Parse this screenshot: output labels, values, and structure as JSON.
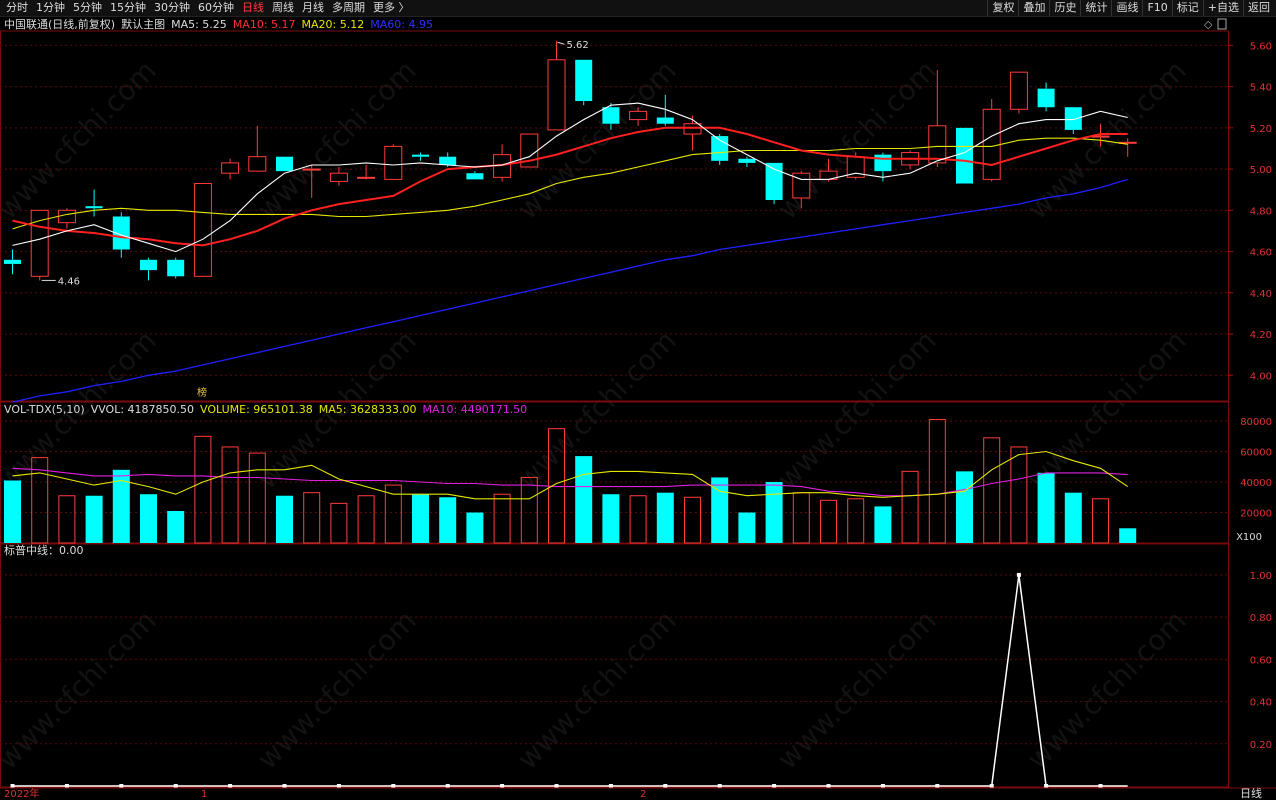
{
  "toolbar": {
    "periods": [
      "分时",
      "1分钟",
      "5分钟",
      "15分钟",
      "30分钟",
      "60分钟",
      "日线",
      "周线",
      "月线",
      "多周期",
      "更多 〉"
    ],
    "active_period": "日线",
    "right_buttons": [
      "复权",
      "叠加",
      "历史",
      "统计",
      "画线",
      "F10",
      "标记",
      "+自选",
      "返回"
    ]
  },
  "main_legend": {
    "stock": "中国联通(日线,前复权)",
    "indicator": "默认主图",
    "ma5": "MA5: 5.25",
    "ma10": "MA10: 5.17",
    "ma20": "MA20: 5.12",
    "ma60": "MA60: 4.95"
  },
  "vol_legend": {
    "name": "VOL-TDX(5,10)",
    "vvol": "VVOL: 4187850.50",
    "volume": "VOLUME: 965101.38",
    "ma5": "MA5: 3628333.00",
    "ma10": "MA10: 4490171.50"
  },
  "ind_legend": {
    "text": "标普中线：0.00"
  },
  "price_axis": [
    "5.60",
    "5.40",
    "5.20",
    "5.00",
    "4.80",
    "4.60",
    "4.40",
    "4.20",
    "4.00"
  ],
  "vol_axis": [
    "80000",
    "60000",
    "40000",
    "20000"
  ],
  "vol_unit": "X100",
  "ind_axis": [
    "1.00",
    "0.80",
    "0.60",
    "0.40",
    "0.20"
  ],
  "annotations": {
    "high": "5.62",
    "low": "4.46",
    "bang": "榜"
  },
  "bottom": {
    "year": "2022年",
    "m1": "1",
    "m2": "2",
    "period": "日线"
  },
  "watermark": "www.cfchi.com",
  "colors": {
    "up": "#ff3b3b",
    "down": "#00ffff",
    "ma5": "#ffffff",
    "ma10": "#ff2020",
    "ma20": "#e6e600",
    "ma60": "#2020ff",
    "vma5": "#e6e600",
    "vma10": "#e020e0"
  },
  "chart_data": {
    "type": "candlestick",
    "price_ylim": [
      3.88,
      5.66
    ],
    "candles": [
      {
        "o": 4.56,
        "c": 4.54,
        "h": 4.61,
        "l": 4.49
      },
      {
        "o": 4.48,
        "c": 4.8,
        "h": 4.8,
        "l": 4.46
      },
      {
        "o": 4.74,
        "c": 4.8,
        "h": 4.81,
        "l": 4.71
      },
      {
        "o": 4.82,
        "c": 4.81,
        "h": 4.9,
        "l": 4.77
      },
      {
        "o": 4.77,
        "c": 4.61,
        "h": 4.79,
        "l": 4.57
      },
      {
        "o": 4.56,
        "c": 4.51,
        "h": 4.57,
        "l": 4.46
      },
      {
        "o": 4.56,
        "c": 4.48,
        "h": 4.57,
        "l": 4.47
      },
      {
        "o": 4.48,
        "c": 4.93,
        "h": 4.93,
        "l": 4.48
      },
      {
        "o": 4.98,
        "c": 5.03,
        "h": 5.05,
        "l": 4.95
      },
      {
        "o": 4.99,
        "c": 5.06,
        "h": 5.21,
        "l": 4.99
      },
      {
        "o": 5.06,
        "c": 4.99,
        "h": 5.06,
        "l": 4.99
      },
      {
        "o": 5.0,
        "c": 5.0,
        "h": 5.02,
        "l": 4.86
      },
      {
        "o": 4.94,
        "c": 4.98,
        "h": 5.01,
        "l": 4.92
      },
      {
        "o": 4.96,
        "c": 4.96,
        "h": 5.02,
        "l": 4.95
      },
      {
        "o": 4.95,
        "c": 5.11,
        "h": 5.12,
        "l": 4.95
      },
      {
        "o": 5.07,
        "c": 5.06,
        "h": 5.08,
        "l": 5.04
      },
      {
        "o": 5.06,
        "c": 5.02,
        "h": 5.08,
        "l": 5.01
      },
      {
        "o": 4.98,
        "c": 4.95,
        "h": 4.99,
        "l": 4.95
      },
      {
        "o": 4.96,
        "c": 5.07,
        "h": 5.12,
        "l": 4.94
      },
      {
        "o": 5.01,
        "c": 5.17,
        "h": 5.17,
        "l": 5.01
      },
      {
        "o": 5.19,
        "c": 5.53,
        "h": 5.62,
        "l": 5.19
      },
      {
        "o": 5.53,
        "c": 5.33,
        "h": 5.53,
        "l": 5.31
      },
      {
        "o": 5.3,
        "c": 5.22,
        "h": 5.32,
        "l": 5.19
      },
      {
        "o": 5.24,
        "c": 5.28,
        "h": 5.3,
        "l": 5.21
      },
      {
        "o": 5.25,
        "c": 5.22,
        "h": 5.36,
        "l": 5.21
      },
      {
        "o": 5.17,
        "c": 5.22,
        "h": 5.26,
        "l": 5.09
      },
      {
        "o": 5.16,
        "c": 5.04,
        "h": 5.17,
        "l": 5.02
      },
      {
        "o": 5.05,
        "c": 5.03,
        "h": 5.06,
        "l": 5.01
      },
      {
        "o": 5.03,
        "c": 4.85,
        "h": 5.03,
        "l": 4.83
      },
      {
        "o": 4.86,
        "c": 4.98,
        "h": 4.99,
        "l": 4.81
      },
      {
        "o": 4.95,
        "c": 4.99,
        "h": 5.05,
        "l": 4.94
      },
      {
        "o": 4.96,
        "c": 5.06,
        "h": 5.08,
        "l": 4.95
      },
      {
        "o": 5.07,
        "c": 4.99,
        "h": 5.08,
        "l": 4.94
      },
      {
        "o": 5.02,
        "c": 5.08,
        "h": 5.09,
        "l": 5.0
      },
      {
        "o": 5.03,
        "c": 5.21,
        "h": 5.48,
        "l": 5.01
      },
      {
        "o": 5.2,
        "c": 4.93,
        "h": 5.2,
        "l": 4.93
      },
      {
        "o": 4.95,
        "c": 5.29,
        "h": 5.34,
        "l": 4.94
      },
      {
        "o": 5.29,
        "c": 5.47,
        "h": 5.47,
        "l": 5.27
      },
      {
        "o": 5.39,
        "c": 5.3,
        "h": 5.42,
        "l": 5.28
      },
      {
        "o": 5.3,
        "c": 5.19,
        "h": 5.3,
        "l": 5.17
      },
      {
        "o": 5.16,
        "c": 5.16,
        "h": 5.22,
        "l": 5.11
      },
      {
        "o": 5.13,
        "c": 5.13,
        "h": 5.15,
        "l": 5.06
      }
    ],
    "ma5": [
      4.63,
      4.66,
      4.7,
      4.73,
      4.68,
      4.64,
      4.6,
      4.66,
      4.75,
      4.88,
      4.98,
      5.02,
      5.02,
      5.03,
      5.02,
      5.03,
      5.02,
      5.01,
      5.02,
      5.06,
      5.16,
      5.24,
      5.31,
      5.32,
      5.29,
      5.24,
      5.14,
      5.07,
      5.0,
      4.95,
      4.95,
      4.98,
      4.96,
      4.98,
      5.04,
      5.08,
      5.16,
      5.22,
      5.24,
      5.24,
      5.28,
      5.25
    ],
    "ma10": [
      4.75,
      4.72,
      4.7,
      4.69,
      4.67,
      4.66,
      4.64,
      4.63,
      4.66,
      4.7,
      4.76,
      4.8,
      4.83,
      4.85,
      4.87,
      4.94,
      5.0,
      5.01,
      5.02,
      5.04,
      5.07,
      5.11,
      5.15,
      5.18,
      5.2,
      5.2,
      5.2,
      5.17,
      5.13,
      5.09,
      5.07,
      5.06,
      5.05,
      5.05,
      5.05,
      5.04,
      5.02,
      5.06,
      5.1,
      5.14,
      5.17,
      5.17
    ],
    "ma20": [
      4.71,
      4.75,
      4.78,
      4.8,
      4.81,
      4.8,
      4.8,
      4.79,
      4.78,
      4.78,
      4.78,
      4.78,
      4.77,
      4.77,
      4.78,
      4.79,
      4.8,
      4.82,
      4.85,
      4.88,
      4.93,
      4.96,
      4.98,
      5.01,
      5.04,
      5.07,
      5.08,
      5.09,
      5.09,
      5.09,
      5.09,
      5.1,
      5.1,
      5.1,
      5.11,
      5.11,
      5.11,
      5.14,
      5.15,
      5.15,
      5.14,
      5.12
    ],
    "ma60": [
      3.87,
      3.9,
      3.92,
      3.95,
      3.97,
      4.0,
      4.02,
      4.05,
      4.08,
      4.11,
      4.14,
      4.17,
      4.2,
      4.23,
      4.26,
      4.29,
      4.32,
      4.35,
      4.38,
      4.41,
      4.44,
      4.47,
      4.5,
      4.53,
      4.56,
      4.58,
      4.61,
      4.63,
      4.65,
      4.67,
      4.69,
      4.71,
      4.73,
      4.75,
      4.77,
      4.79,
      4.81,
      4.83,
      4.86,
      4.88,
      4.91,
      4.95
    ],
    "vol_ylim": [
      0,
      82000
    ],
    "volume": [
      41000,
      56000,
      31000,
      31000,
      48000,
      32000,
      21000,
      70000,
      63000,
      59000,
      31000,
      33000,
      26000,
      31000,
      38000,
      32000,
      30000,
      20000,
      32000,
      43000,
      75000,
      57000,
      32000,
      31000,
      33000,
      30000,
      43000,
      20000,
      40000,
      33000,
      28000,
      29000,
      24000,
      47000,
      81000,
      47000,
      69000,
      63000,
      46000,
      33000,
      29000,
      9650
    ],
    "vol_ma5": [
      44000,
      46000,
      42000,
      38000,
      41000,
      37000,
      32000,
      40000,
      46000,
      48000,
      48000,
      51000,
      42000,
      37000,
      32000,
      32000,
      32000,
      29000,
      29000,
      29000,
      39000,
      45000,
      47000,
      47000,
      46000,
      45000,
      34000,
      31000,
      32000,
      33000,
      33000,
      31000,
      30000,
      31000,
      32000,
      34000,
      48000,
      58000,
      60000,
      54000,
      49000,
      37000
    ],
    "vol_ma10": [
      49000,
      48000,
      46000,
      44000,
      44000,
      45000,
      44000,
      44000,
      43000,
      43000,
      42000,
      41000,
      41000,
      41000,
      41000,
      40000,
      39000,
      39000,
      38000,
      38000,
      37000,
      37000,
      37000,
      37000,
      37000,
      38000,
      38000,
      38000,
      38000,
      37000,
      34000,
      33000,
      31000,
      31000,
      32000,
      35000,
      39000,
      42000,
      46000,
      46000,
      46000,
      44900
    ],
    "indicator": [
      0,
      0,
      0,
      0,
      0,
      0,
      0,
      0,
      0,
      0,
      0,
      0,
      0,
      0,
      0,
      0,
      0,
      0,
      0,
      0,
      0,
      0,
      0,
      0,
      0,
      0,
      0,
      0,
      0,
      0,
      0,
      0,
      0,
      0,
      0,
      0,
      0,
      1,
      0,
      0,
      0,
      0
    ],
    "ind_ylim": [
      0,
      1.08
    ]
  }
}
